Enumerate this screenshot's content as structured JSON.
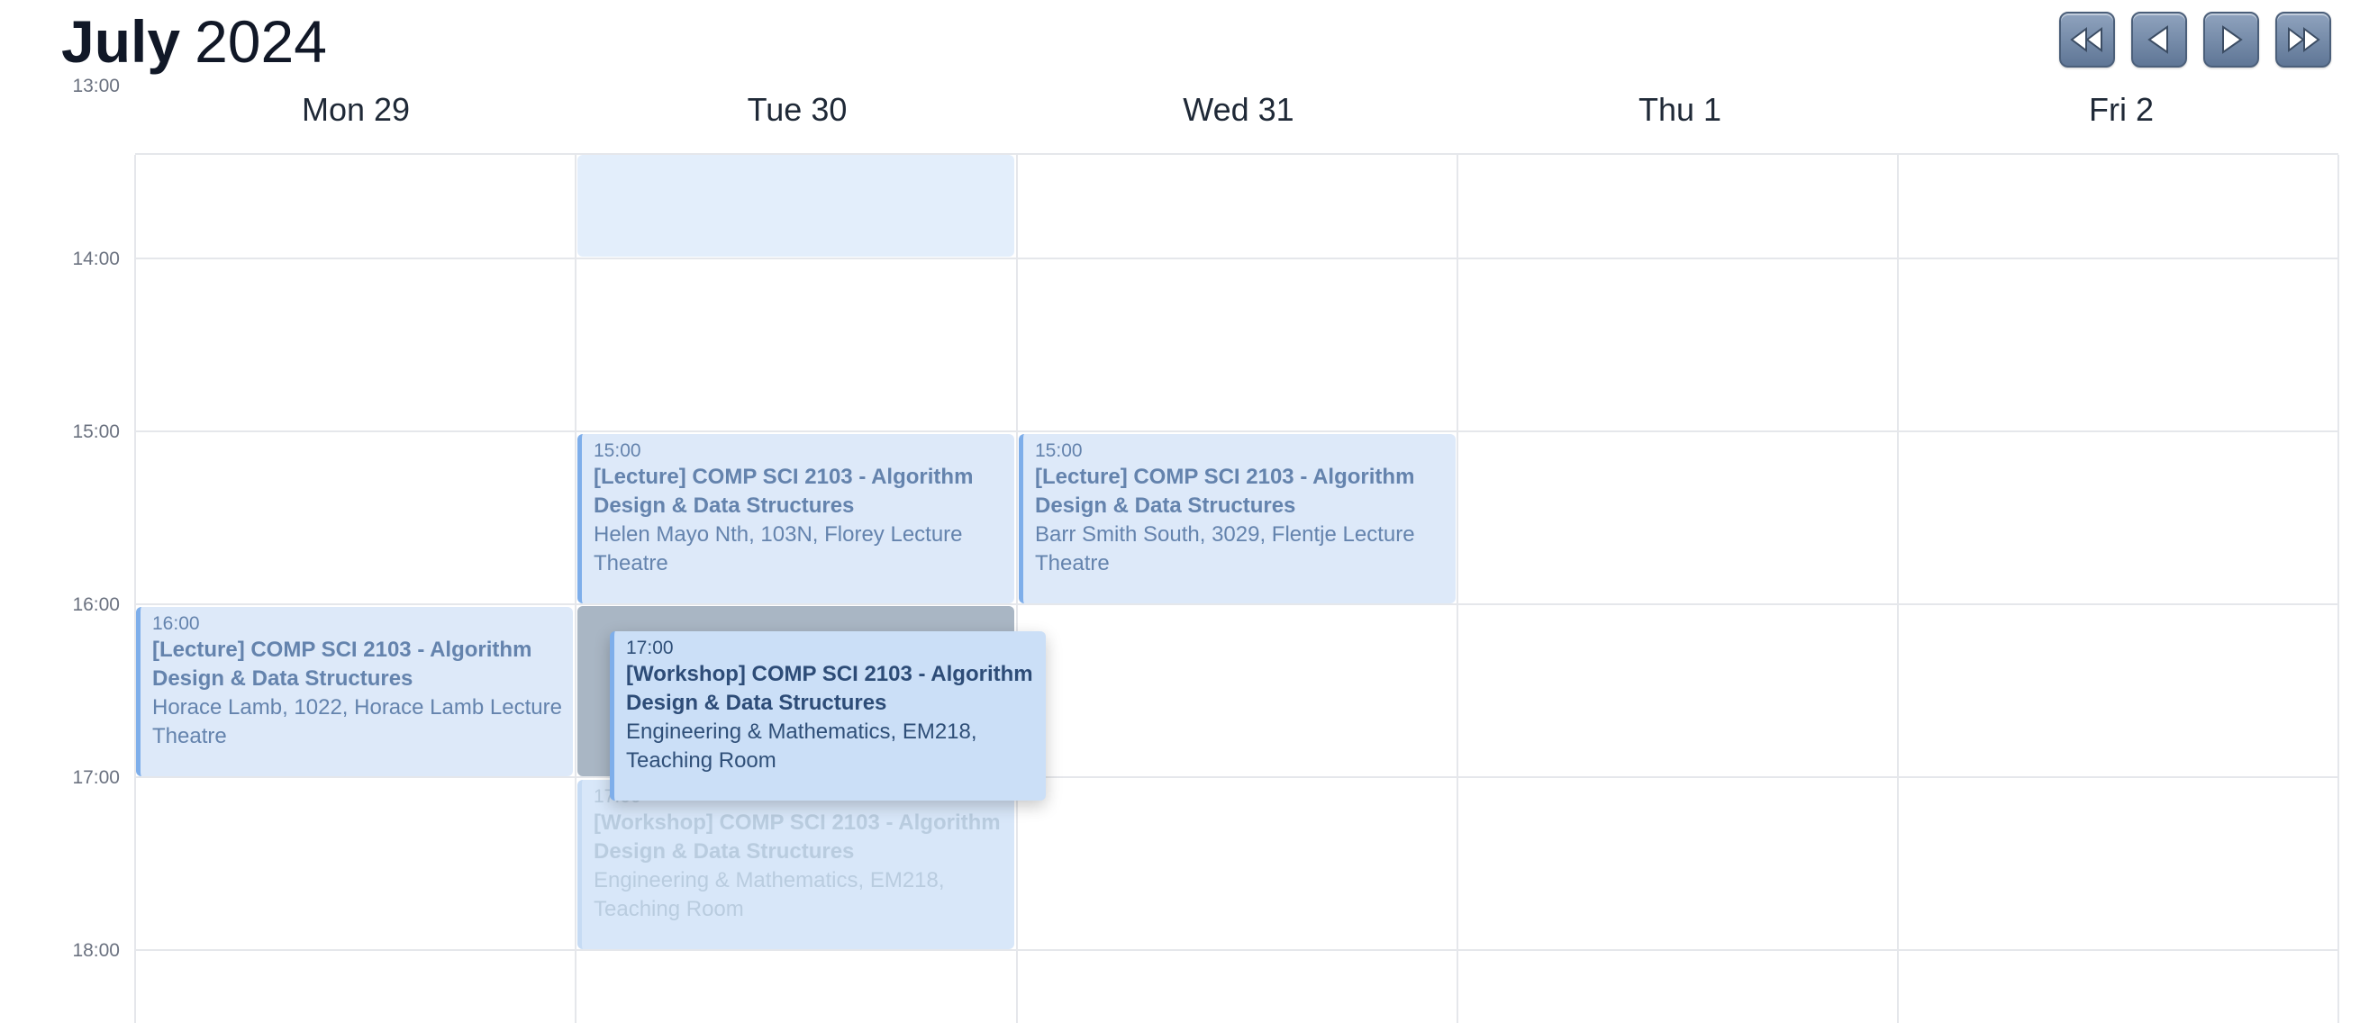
{
  "header": {
    "month": "July",
    "year": "2024"
  },
  "nav": {
    "first_icon": "double-chevron-left-icon",
    "prev_icon": "play-left-icon",
    "next_icon": "play-right-icon",
    "last_icon": "double-chevron-right-icon",
    "button_color": "#6b82a3"
  },
  "days": [
    {
      "label": "Mon 29"
    },
    {
      "label": "Tue 30"
    },
    {
      "label": "Wed 31"
    },
    {
      "label": "Thu 1"
    },
    {
      "label": "Fri 2"
    }
  ],
  "times": [
    "13:00",
    "14:00",
    "15:00",
    "16:00",
    "17:00",
    "18:00"
  ],
  "events": [
    {
      "time": "16:00",
      "title": "[Lecture] COMP SCI 2103 - Algorithm Design & Data Structures",
      "location": "Horace Lamb, 1022, Horace Lamb Lecture Theatre"
    },
    {
      "time": "15:00",
      "title": "[Lecture] COMP SCI 2103 - Algorithm Design & Data Structures",
      "location": "Helen Mayo Nth, 103N, Florey Lecture Theatre"
    },
    {
      "time": "15:00",
      "title": "[Lecture] COMP SCI 2103 - Algorithm Design & Data Structures",
      "location": "Barr Smith South, 3029, Flentje Lecture Theatre"
    },
    {
      "time": "17:00",
      "title": "[Workshop] COMP SCI 2103 - Algorithm Design & Data Structures",
      "location": "Engineering & Mathematics, EM218, Teaching Room"
    },
    {
      "time": "17:00",
      "title": "[Workshop] COMP SCI 2103 - Algorithm Design & Data Structures",
      "location": "Engineering & Mathematics, EM218, Teaching Room"
    }
  ],
  "colors": {
    "event_bg": "#dde9f9",
    "event_border": "#7eaeea",
    "event_text": "#6483ad",
    "drop_target": "#a9b6c4"
  }
}
